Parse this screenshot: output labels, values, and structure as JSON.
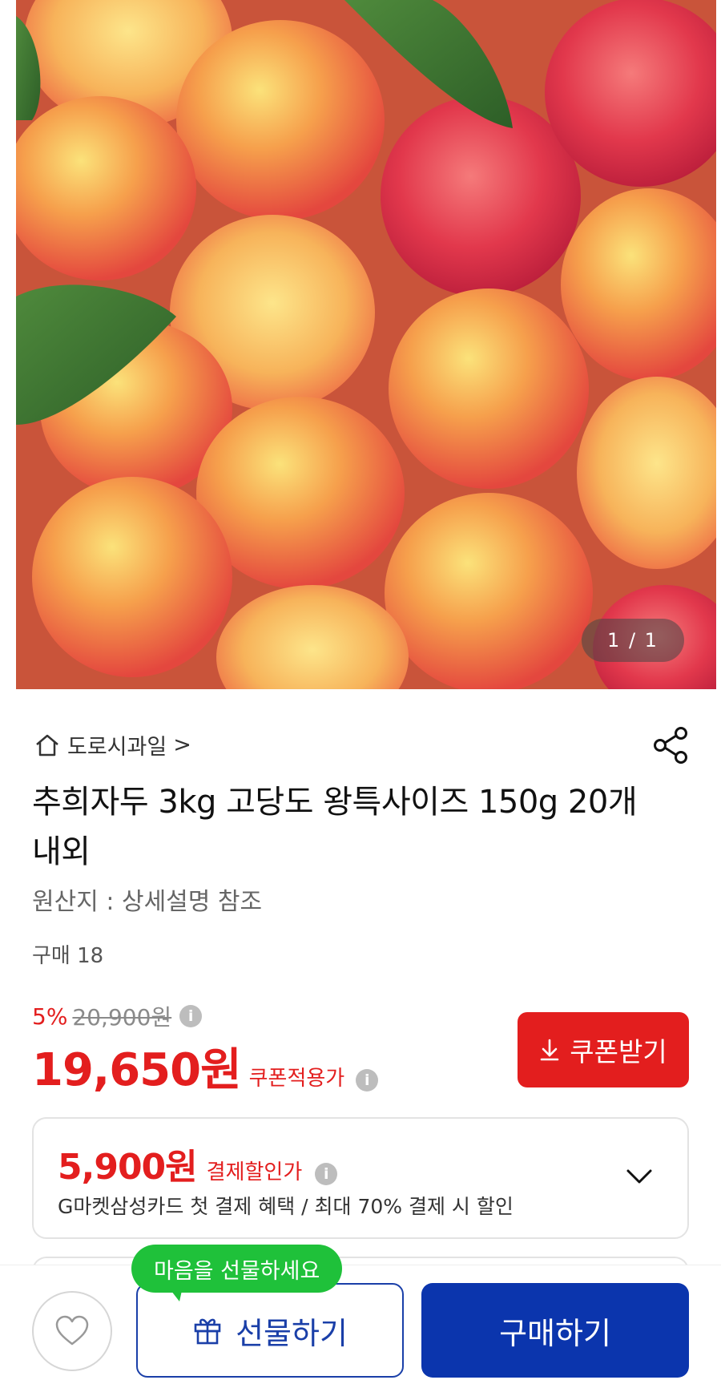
{
  "gallery": {
    "counter": "1 / 1"
  },
  "store": {
    "name": "도로시과일",
    "arrow": ">"
  },
  "product": {
    "title": "추희자두 3kg 고당도 왕특사이즈 150g 20개내외",
    "origin": "원산지 : 상세설명 참조",
    "purchases": "구매 18"
  },
  "price": {
    "discount_rate": "5%",
    "original": "20,900원",
    "final": "19,650원",
    "final_label": "쿠폰적용가",
    "info_glyph": "i"
  },
  "coupon_button": {
    "label": "쿠폰받기"
  },
  "card_offer": {
    "price": "5,900원",
    "label": "결제할인가",
    "description": "G마켓삼성카드 첫 결제 혜택 / 최대 70% 결제 시 할인"
  },
  "bottom": {
    "tooltip": "마음을 선물하세요",
    "gift_label": "선물하기",
    "buy_label": "구매하기"
  },
  "colors": {
    "accent_red": "#e31e1e",
    "brand_blue": "#0b35ad",
    "tooltip_green": "#1fc13a"
  },
  "icons": [
    "home-icon",
    "share-icon",
    "info-icon",
    "download-icon",
    "chevron-down-icon",
    "heart-icon",
    "gift-icon"
  ]
}
